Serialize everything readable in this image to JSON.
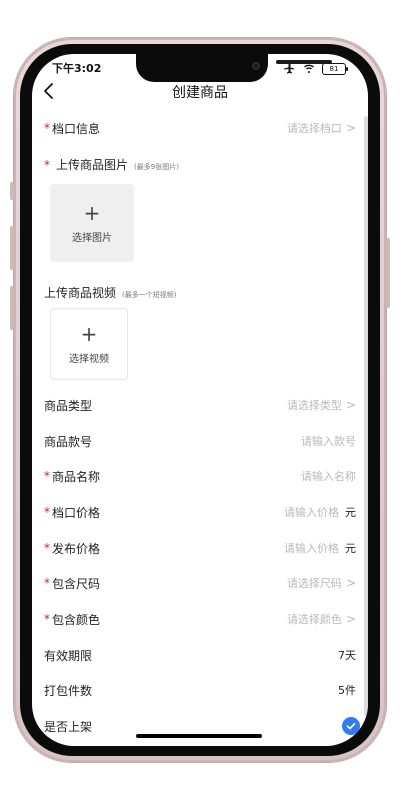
{
  "status": {
    "time": "下午3:02",
    "battery": "81"
  },
  "nav": {
    "title": "创建商品"
  },
  "form": {
    "stall": {
      "label": "档口信息",
      "placeholder": "请选择档口"
    },
    "images": {
      "title": "上传商品图片",
      "subtitle": "(最多9张图片)",
      "upload_label": "选择图片"
    },
    "video": {
      "title": "上传商品视频",
      "subtitle": "(最多一个短视频)",
      "upload_label": "选择视频"
    },
    "type": {
      "label": "商品类型",
      "placeholder": "请选择类型"
    },
    "style_no": {
      "label": "商品款号",
      "placeholder": "请输入款号"
    },
    "name": {
      "label": "商品名称",
      "placeholder": "请输入名称"
    },
    "stall_price": {
      "label": "档口价格",
      "placeholder": "请输入价格",
      "unit": "元"
    },
    "publish_price": {
      "label": "发布价格",
      "placeholder": "请输入价格",
      "unit": "元"
    },
    "sizes": {
      "label": "包含尺码",
      "placeholder": "请选择尺码"
    },
    "colors": {
      "label": "包含颜色",
      "placeholder": "请选择颜色"
    },
    "validity": {
      "label": "有效期限",
      "value": "7天"
    },
    "pack_count": {
      "label": "打包件数",
      "value": "5件"
    },
    "listed": {
      "label": "是否上架",
      "checked": true
    }
  },
  "colors": {
    "accent": "#2f7cf6",
    "required": "#d22222"
  }
}
